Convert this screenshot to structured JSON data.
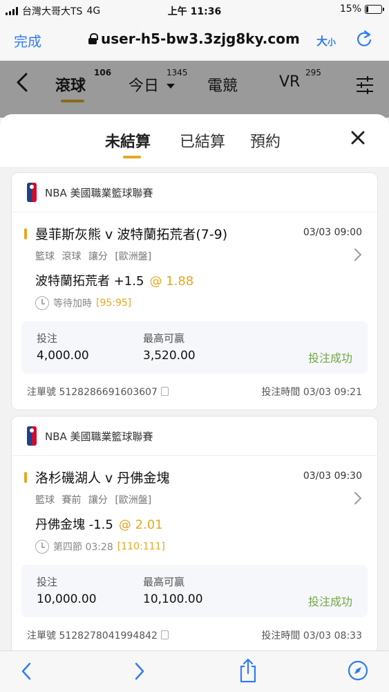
{
  "status_bar": {
    "carrier": "台灣大哥大TS",
    "network": "4G",
    "time": "上午 11:36",
    "battery_percent": "15%",
    "battery_level": 0.15
  },
  "browser": {
    "done_label": "完成",
    "url": "user-h5-bw3.3zjg8ky.com",
    "text_size_big": "大",
    "text_size_small": "小",
    "icons": [
      "lock-icon",
      "reload-icon"
    ]
  },
  "app_nav": {
    "items": [
      {
        "label": "滾球",
        "count": "106"
      },
      {
        "label": "今日",
        "count": "1345"
      },
      {
        "label": "電競",
        "count": ""
      },
      {
        "label": "VR",
        "count": "295"
      }
    ],
    "icons": [
      "back-icon",
      "dropdown-arrow-icon",
      "filter-menu-icon"
    ]
  },
  "sheet": {
    "tabs": [
      "未結算",
      "已結算",
      "預約"
    ],
    "active_tab": "未結算"
  },
  "bets": [
    {
      "league": "NBA 美國職業籃球聯賽",
      "match": "曼菲斯灰熊 v 波特蘭拓荒者(7-9)",
      "match_time": "03/03 09:00",
      "tags": "籃球 滾球 讓分 [歐洲盤]",
      "selection": "波特蘭拓荒者 +1.5",
      "odds": "@ 1.88",
      "game_status": "等待加時",
      "score": "[95:95]",
      "stake_label": "投注",
      "stake": "4,000.00",
      "max_win_label": "最高可贏",
      "max_win": "3,520.00",
      "result": "投注成功",
      "ticket": "注單號 5128286691603607",
      "bet_time": "投注時間 03/03 09:21"
    },
    {
      "league": "NBA 美國職業籃球聯賽",
      "match": "洛杉磯湖人 v 丹佛金塊",
      "match_time": "03/03 09:30",
      "tags": "籃球 賽前 讓分 [歐洲盤]",
      "selection": "丹佛金塊 -1.5",
      "odds": "@ 2.01",
      "game_status": "第四節 03:28",
      "score": "[110:111]",
      "stake_label": "投注",
      "stake": "10,000.00",
      "max_win_label": "最高可贏",
      "max_win": "10,100.00",
      "result": "投注成功",
      "ticket": "注單號 5128278041994842",
      "bet_time": "投注時間 03/03 08:33"
    }
  ],
  "colors": {
    "accent": "#e6a722",
    "success": "#6fa844",
    "link": "#2f7cf6"
  }
}
